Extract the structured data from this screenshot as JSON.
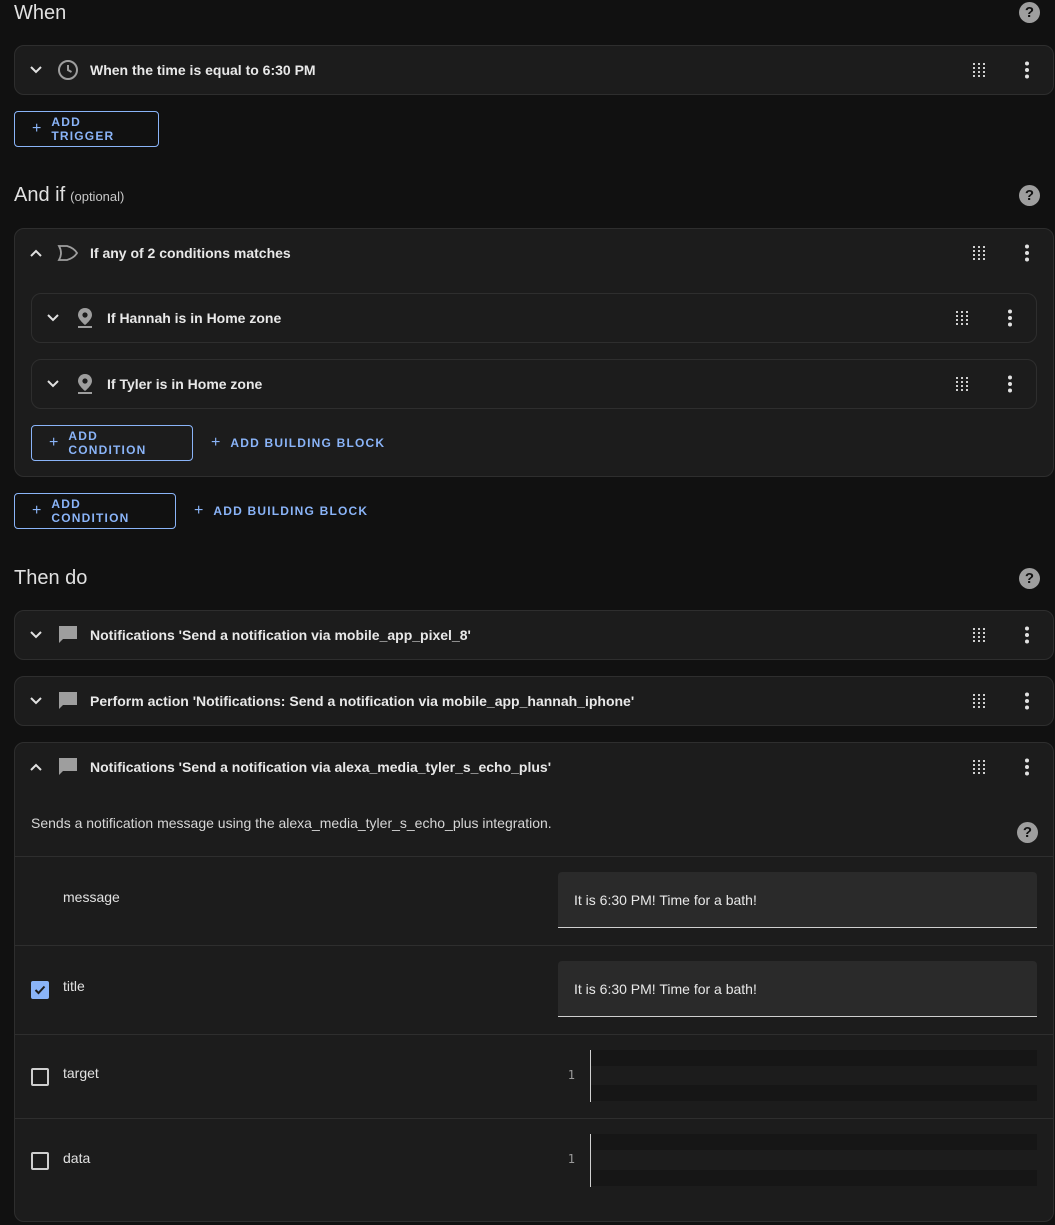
{
  "sections": {
    "when_title": "When",
    "andif_title": "And if",
    "andif_optional": "(optional)",
    "then_title": "Then do",
    "help_glyph": "?"
  },
  "triggers": [
    {
      "label": "When the time is equal to 6:30 PM",
      "icon": "clock-icon"
    }
  ],
  "add_trigger_label": "ADD TRIGGER",
  "condition_group": {
    "label": "If any of 2 conditions matches",
    "icon": "or-gate-icon",
    "children": [
      {
        "label": "If Hannah is in Home zone",
        "icon": "map-marker-icon"
      },
      {
        "label": "If Tyler is in Home zone",
        "icon": "map-marker-icon"
      }
    ],
    "add_condition_label": "ADD CONDITION",
    "add_building_block_label": "ADD BUILDING BLOCK"
  },
  "root_add_condition_label": "ADD CONDITION",
  "root_add_building_block_label": "ADD BUILDING BLOCK",
  "actions": [
    {
      "label": "Notifications 'Send a notification via mobile_app_pixel_8'",
      "icon": "message-icon"
    },
    {
      "label": "Perform action 'Notifications: Send a notification via mobile_app_hannah_iphone'",
      "icon": "message-icon"
    },
    {
      "label": "Notifications 'Send a notification via alexa_media_tyler_s_echo_plus'",
      "icon": "message-icon"
    }
  ],
  "expanded_action": {
    "description": "Sends a notification message using the alexa_media_tyler_s_echo_plus integration.",
    "fields": {
      "message": {
        "label": "message",
        "value": "It is 6:30 PM! Time for a bath!"
      },
      "title": {
        "label": "title",
        "value": "It is 6:30 PM! Time for a bath!",
        "checked": true
      },
      "target": {
        "label": "target",
        "line_number": "1",
        "checked": false
      },
      "data": {
        "label": "data",
        "line_number": "1",
        "checked": false
      }
    }
  },
  "colors": {
    "accent": "#8ab4f8",
    "background": "#111111",
    "card": "#1c1c1c"
  }
}
